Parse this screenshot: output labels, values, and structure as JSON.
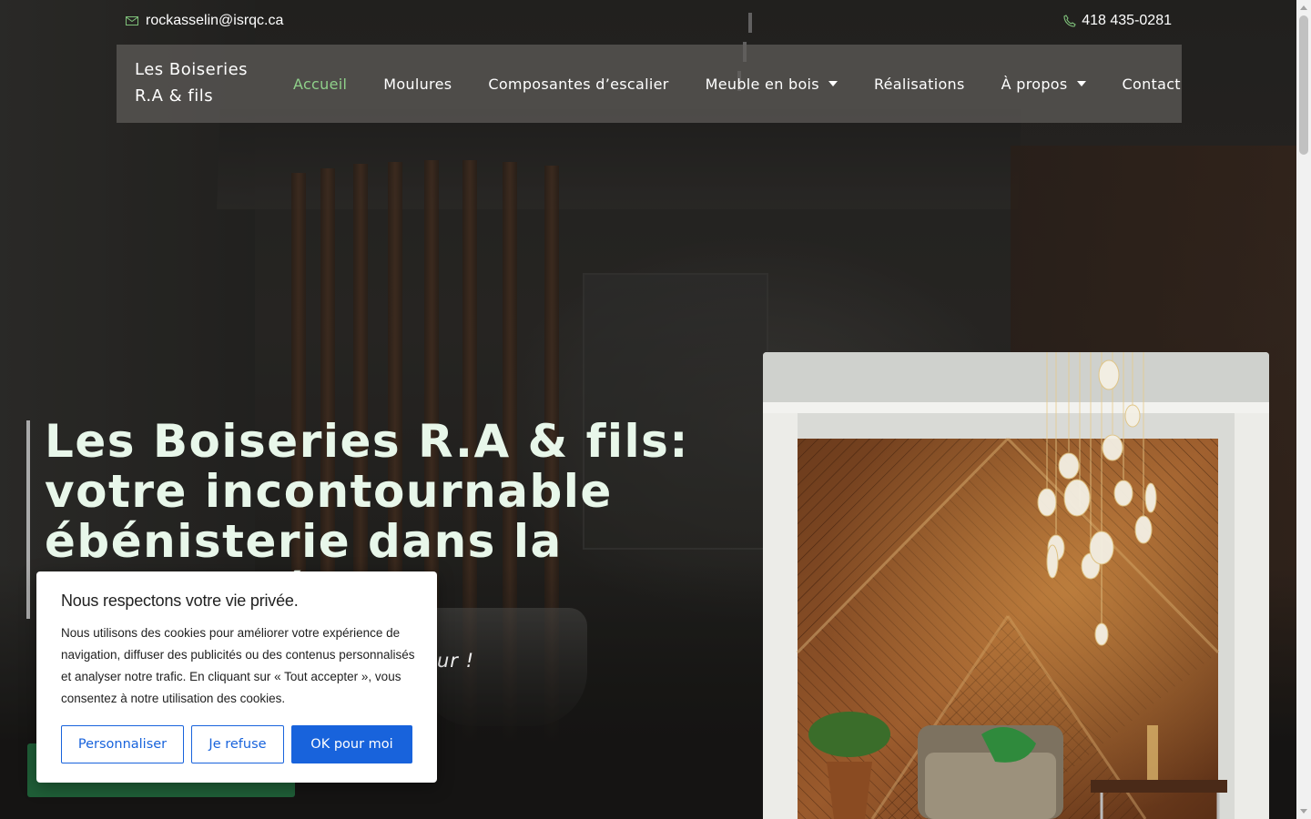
{
  "topbar": {
    "email": "rockasselin@isrqc.ca",
    "phone": "418 435-0281",
    "email_icon": "mail-icon",
    "phone_icon": "phone-icon"
  },
  "nav": {
    "brand": "Les Boiseries R.A & fils",
    "items": [
      {
        "label": "Accueil",
        "active": true,
        "dropdown": false
      },
      {
        "label": "Moulures",
        "active": false,
        "dropdown": false
      },
      {
        "label": "Composantes d’escalier",
        "active": false,
        "dropdown": false
      },
      {
        "label": "Meuble en bois",
        "active": false,
        "dropdown": true
      },
      {
        "label": "Réalisations",
        "active": false,
        "dropdown": false
      },
      {
        "label": "À propos",
        "active": false,
        "dropdown": true
      },
      {
        "label": "Contact",
        "active": false,
        "dropdown": false
      }
    ]
  },
  "hero": {
    "title": "Les Boiseries R.A & fils: votre incontournable ébénisterie dans la grande région de",
    "subtitle_visible": "ur !"
  },
  "cookie": {
    "title": "Nous respectons votre vie privée.",
    "body": "Nous utilisons des cookies pour améliorer votre expérience de navigation, diffuser des publicités ou des contenus personnalisés et analyser notre trafic. En cliquant sur « Tout accepter », vous consentez à notre utilisation des cookies.",
    "customize_label": "Personnaliser",
    "refuse_label": "Je refuse",
    "accept_label": "OK pour moi"
  },
  "colors": {
    "active_nav": "#8fd08a",
    "hero_title": "#e8f7ea",
    "cookie_accent": "#1863dc",
    "cta_green": "#1f5e37"
  }
}
